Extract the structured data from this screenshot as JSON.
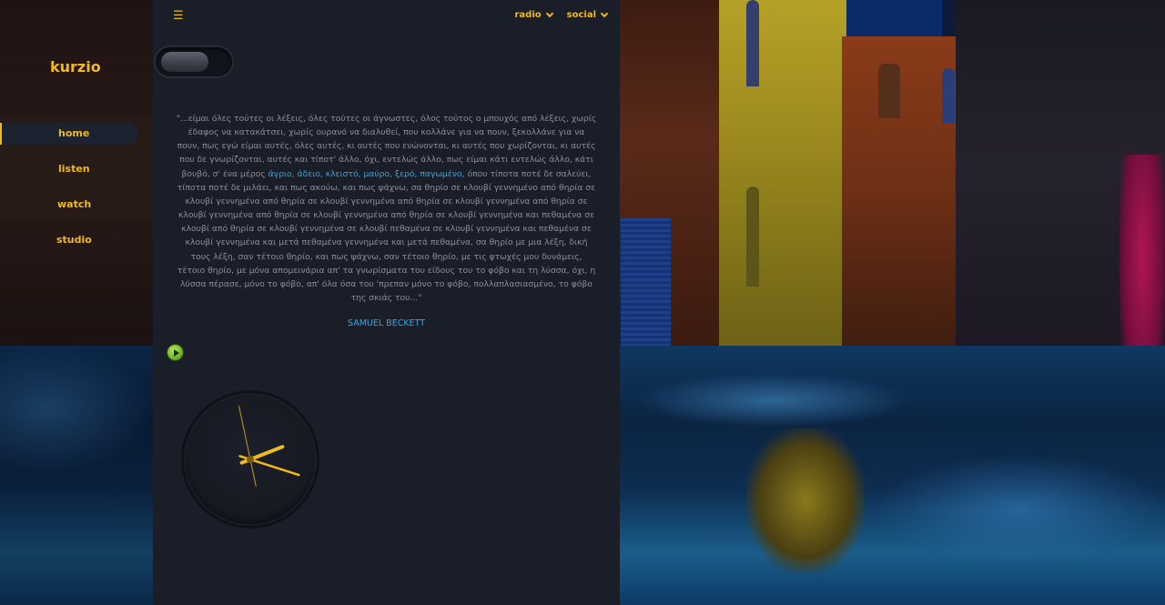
{
  "sidebar": {
    "brand": "kurzio",
    "items": [
      {
        "label": "home",
        "active": true
      },
      {
        "label": "listen",
        "active": false
      },
      {
        "label": "watch",
        "active": false
      },
      {
        "label": "studio",
        "active": false
      }
    ]
  },
  "header": {
    "menu_icon": "hamburger-icon",
    "menus": [
      {
        "label": "radio",
        "icon": "chevron-down-icon"
      },
      {
        "label": "social",
        "icon": "chevron-down-icon"
      }
    ]
  },
  "main": {
    "toggle": {
      "state": "off"
    },
    "quote": {
      "part1": "\"...είμαι όλες τούτες οι λέξεις, όλες τούτες οι άγνωστες, όλος τούτος ο μπουχός από λέξεις, χωρίς έδαφος να κατακάτσει, χωρίς ουρανό να διαλυθεί, που κολλάνε για να πουν, ξεκολλάνε για να πουν, πως εγώ είμαι αυτές, όλες αυτές, κι αυτές που ενώνονται, κι αυτές που χωρίζονται, κι αυτές που δε γνωρίζονται, αυτές και τίποτ' άλλο, όχι, εντελώς άλλο, πως είμαι κάτι εντελώς άλλο, κάτι βουβό, σ' ένα μέρος ",
      "highlight": "άγριο, άδειο, κλειστό, μαύρο, ξερό, παγωμένο,",
      "part2": " όπου τίποτα ποτέ δε σαλεύει, τίποτα ποτέ δε μιλάει, και πως ακούω, και πως ψάχνω, σα θηρίο σε κλουβί γεννημένο από θηρία σε κλουβί γεννημένα από θηρία σε κλουβί γεννημένα από θηρία σε κλουβί γεννημένα από θηρία σε κλουβί γεννημένα από θηρία σε κλουβί γεννημένα από θηρία σε κλουβί γεννημένα και πεθαμένα σε κλουβί από θηρία σε κλουβί γεννημένα σε κλουβί πεθαμένα σε κλουβί γεννημένα και πεθαμένα σε κλουβί γεννημένα και μετά πεθαμένα γεννημένα και μετά πεθαμένα, σα θηρίο με μια λέξη, δική τους λέξη, σαν τέτοιο θηρίο, και πως ψάχνω, σαν τέτοιο θηρίο, με τις φτωχές μου δυνάμεις, τέτοιο θηρίο, με μόνα απομεινάρια απ' τα γνωρίσματα του είδους του το φόβο και τη λύσσα, όχι, η λύσσα πέρασε, μόνο το φόβο, απ' όλα όσα του 'πρεπαν μόνο το φόβο, πολλαπλασιασμένο, το φόβο της σκιάς του...\""
    },
    "author": "SAMUEL BECKETT",
    "player": {
      "icon": "play-icon"
    },
    "clock": {
      "hour": 2,
      "minute": 17,
      "second": 58
    }
  },
  "colors": {
    "accent": "#f0b91e",
    "link": "#33a7e8",
    "panel": "#1a1e28",
    "play": "#7bc12e"
  }
}
